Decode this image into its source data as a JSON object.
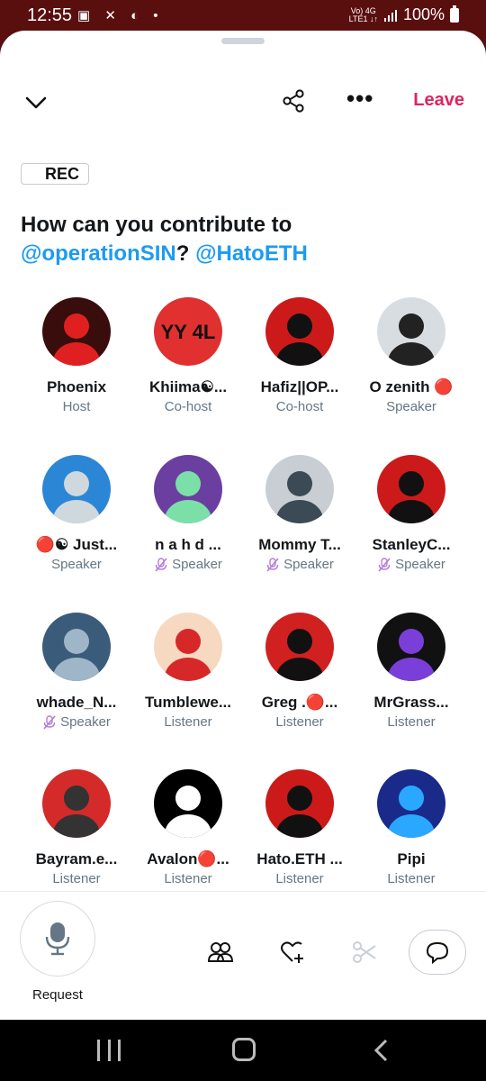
{
  "status_bar": {
    "time": "12:55",
    "left_icons": "▣ ✕ ◐ •",
    "network_top": "Vo) 4G",
    "network_bottom": "LTE1 ↓↑",
    "battery": "100%"
  },
  "toolbar": {
    "leave_label": "Leave",
    "more_label": "•••"
  },
  "rec_label": "REC",
  "space_title": {
    "prefix": "How can you contribute to",
    "mention1": "@operationSIN",
    "separator": "? ",
    "mention2": "@HatoETH"
  },
  "participants": [
    {
      "name": "Phoenix",
      "role": "Host",
      "muted": false,
      "avatar_bg": "#3a0d0d",
      "avatar_fg": "#e02020"
    },
    {
      "name": "Khiima☯...",
      "role": "Co-host",
      "muted": false,
      "avatar_bg": "#e03030",
      "avatar_fg": "#111111",
      "avatar_text": "YY 4L"
    },
    {
      "name": "Hafiz||OP...",
      "role": "Co-host",
      "muted": false,
      "avatar_bg": "#cc1a1a",
      "avatar_fg": "#111111"
    },
    {
      "name": "O zenith 🔴",
      "role": "Speaker",
      "muted": false,
      "avatar_bg": "#d8dde2",
      "avatar_fg": "#222222"
    },
    {
      "name": "🔴☯ Just...",
      "role": "Speaker",
      "muted": false,
      "avatar_bg": "#2c86d6",
      "avatar_fg": "#cfd8dc"
    },
    {
      "name": "n a h d ...",
      "role": "Speaker",
      "muted": true,
      "avatar_bg": "#6b3fa0",
      "avatar_fg": "#7be0a8"
    },
    {
      "name": "Mommy T...",
      "role": "Speaker",
      "muted": true,
      "avatar_bg": "#c8ced3",
      "avatar_fg": "#3b4a55"
    },
    {
      "name": "StanleyC...",
      "role": "Speaker",
      "muted": true,
      "avatar_bg": "#cc1a1a",
      "avatar_fg": "#111111"
    },
    {
      "name": "whade_N...",
      "role": "Speaker",
      "muted": true,
      "avatar_bg": "#3b5b7a",
      "avatar_fg": "#9fb6c9"
    },
    {
      "name": "Tumblewe...",
      "role": "Listener",
      "muted": false,
      "avatar_bg": "#f6d9c0",
      "avatar_fg": "#d62828"
    },
    {
      "name": "Greg .🔴...",
      "role": "Listener",
      "muted": false,
      "avatar_bg": "#d12020",
      "avatar_fg": "#111111"
    },
    {
      "name": "MrGrass...",
      "role": "Listener",
      "muted": false,
      "avatar_bg": "#111111",
      "avatar_fg": "#7a3fd8"
    },
    {
      "name": "Bayram.e...",
      "role": "Listener",
      "muted": false,
      "avatar_bg": "#d42a2a",
      "avatar_fg": "#333333"
    },
    {
      "name": "Avalon🔴...",
      "role": "Listener",
      "muted": false,
      "avatar_bg": "#000000",
      "avatar_fg": "#ffffff"
    },
    {
      "name": "Hato.ETH ...",
      "role": "Listener",
      "muted": false,
      "avatar_bg": "#cc1a1a",
      "avatar_fg": "#111111"
    },
    {
      "name": "Pipi",
      "role": "Listener",
      "muted": false,
      "avatar_bg": "#1a2a8a",
      "avatar_fg": "#2aa8ff"
    }
  ],
  "bottom_bar": {
    "request_label": "Request"
  },
  "colors": {
    "accent": "#1d9bf0",
    "leave": "#e0245e",
    "status_bg": "#5a0f0f"
  }
}
